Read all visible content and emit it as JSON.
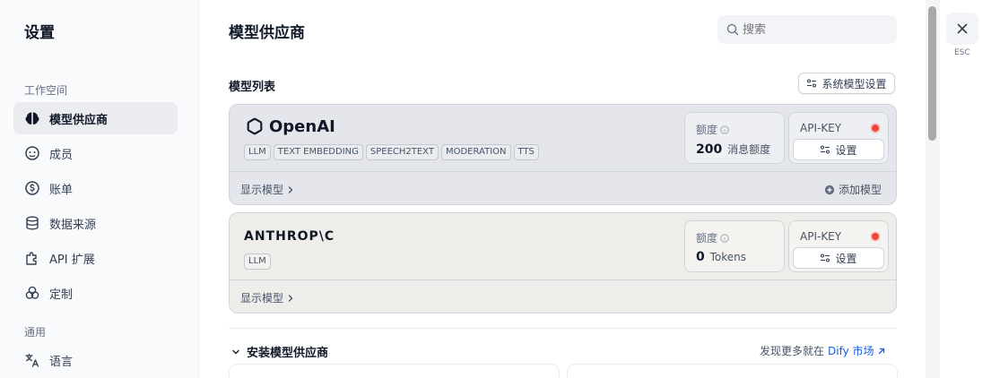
{
  "sidebar": {
    "title": "设置",
    "section_workspace": "工作空间",
    "section_general": "通用",
    "items": [
      {
        "label": "模型供应商",
        "icon": "brain-icon",
        "active": true
      },
      {
        "label": "成员",
        "icon": "members-icon"
      },
      {
        "label": "账单",
        "icon": "billing-icon"
      },
      {
        "label": "数据来源",
        "icon": "database-icon"
      },
      {
        "label": "API 扩展",
        "icon": "puzzle-icon"
      },
      {
        "label": "定制",
        "icon": "customize-icon"
      },
      {
        "label": "语言",
        "icon": "language-icon"
      }
    ]
  },
  "header": {
    "title": "模型供应商",
    "search_placeholder": "搜索"
  },
  "model_list": {
    "title": "模型列表",
    "system_settings_label": "系统模型设置"
  },
  "providers": [
    {
      "name": "OpenAI",
      "tags": [
        "LLM",
        "TEXT EMBEDDING",
        "SPEECH2TEXT",
        "MODERATION",
        "TTS"
      ],
      "quota_label": "额度",
      "quota_value": "200",
      "quota_unit": "消息额度",
      "key_label": "API-KEY",
      "key_button": "设置",
      "show_models": "显示模型",
      "add_model": "添加模型"
    },
    {
      "name": "ANTHROP\\C",
      "tags": [
        "LLM"
      ],
      "quota_label": "额度",
      "quota_value": "0",
      "quota_unit": "Tokens",
      "key_label": "API-KEY",
      "key_button": "设置",
      "show_models": "显示模型"
    }
  ],
  "install": {
    "title": "安装模型供应商",
    "discover_text": "发现更多就在",
    "market_link": "Dify 市场"
  },
  "close": {
    "esc_label": "ESC"
  },
  "colors": {
    "status_error": "#f04438",
    "link": "#155eef",
    "openai_card_bg": "#e4e6eb",
    "anthropic_card_bg": "#eeede9"
  }
}
